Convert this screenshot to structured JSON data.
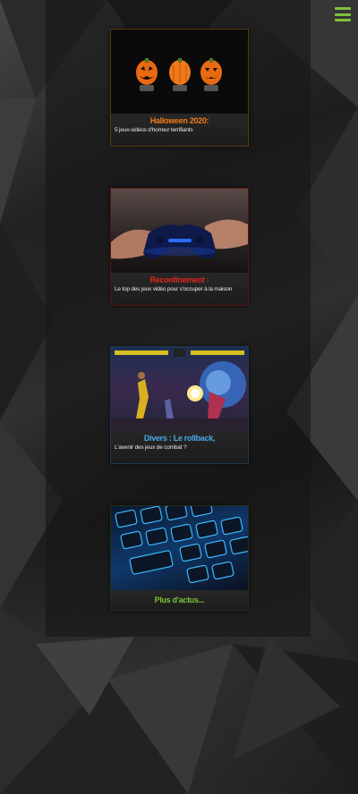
{
  "header": {
    "menu_icon": "hamburger-menu-icon",
    "accent": "#7ec13a"
  },
  "cards": [
    {
      "title": "Halloween 2020:",
      "subtitle": "5 jeux-vidéos d'horreur terrifiants",
      "title_color": "#f07a1a",
      "border_color": "#5a3a12",
      "image_icon": "pumpkins-image"
    },
    {
      "title": "Reconfinement :",
      "subtitle": "Le top des jeux vidéo pour s'occuper à la maison",
      "title_color": "#e0281c",
      "border_color": "#5a1410",
      "image_icon": "gamepad-image"
    },
    {
      "title": "Divers : Le rollback,",
      "subtitle": "L'avenir des jeux de combat ?",
      "title_color": "#4aa8e8",
      "border_color": "#1c3850",
      "image_icon": "fighting-game-image"
    }
  ],
  "more": {
    "label": "Plus d'actus...",
    "image_icon": "gaming-keyboard-image",
    "color": "#7ec13a"
  }
}
